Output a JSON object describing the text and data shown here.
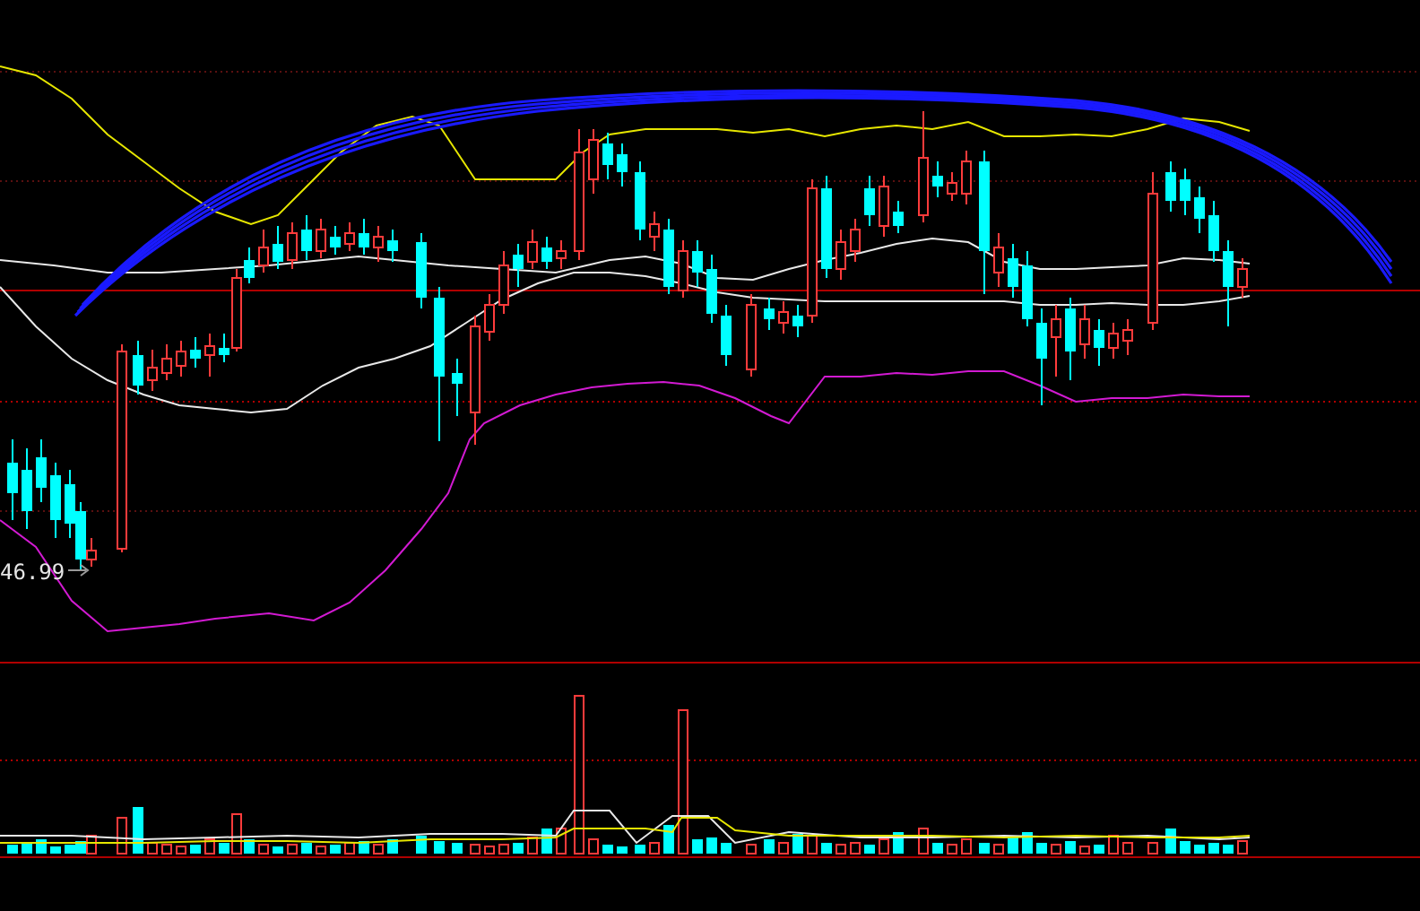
{
  "price_chart": {
    "low_price_label": "46.99"
  }
}
